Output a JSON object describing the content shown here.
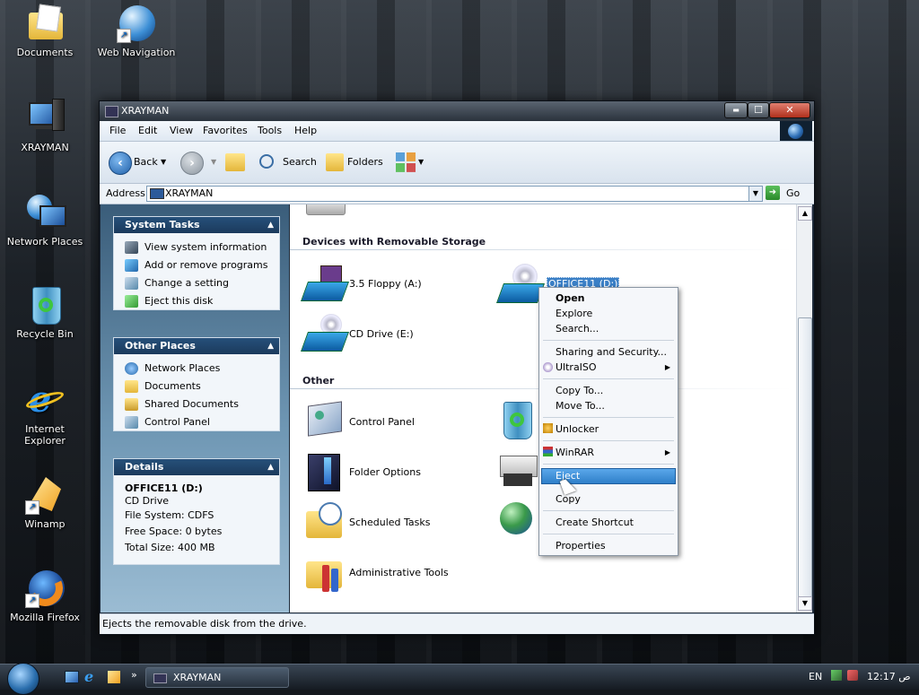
{
  "desktop": {
    "icons": [
      {
        "label": "Documents"
      },
      {
        "label": "Web Navigation"
      },
      {
        "label": "XRAYMAN"
      },
      {
        "label": "Network Places"
      },
      {
        "label": "Recycle Bin"
      },
      {
        "label": "Internet Explorer"
      },
      {
        "label": "Winamp"
      },
      {
        "label": "Mozilla Firefox"
      }
    ]
  },
  "window": {
    "title": "XRAYMAN",
    "buttons": {
      "minimize": "▬",
      "maximize": "☐",
      "close": "✕"
    }
  },
  "menu": [
    "File",
    "Edit",
    "View",
    "Favorites",
    "Tools",
    "Help"
  ],
  "toolbar": {
    "back": "Back",
    "search": "Search",
    "folders": "Folders"
  },
  "address": {
    "label": "Address",
    "value": "XRAYMAN",
    "go": "Go"
  },
  "sidebar": {
    "system_tasks": {
      "title": "System Tasks",
      "items": [
        "View system information",
        "Add or remove programs",
        "Change a setting",
        "Eject this disk"
      ]
    },
    "other_places": {
      "title": "Other Places",
      "items": [
        "Network Places",
        "Documents",
        "Shared Documents",
        "Control Panel"
      ]
    },
    "details": {
      "title": "Details",
      "name": "OFFICE11 (D:)",
      "type": "CD Drive",
      "filesystem": "File System: CDFS",
      "free": "Free Space: 0 bytes",
      "total": "Total Size: 400 MB"
    }
  },
  "content": {
    "removable_header": "Devices with Removable Storage",
    "removable": [
      "3.5 Floppy (A:)",
      "OFFICE11 (D:)",
      "CD Drive (E:)"
    ],
    "other_header": "Other",
    "other": [
      "Control Panel",
      "Folder Options",
      "Scheduled Tasks",
      "Administrative Tools"
    ]
  },
  "context_menu": {
    "items": [
      "Open",
      "Explore",
      "Search...",
      "Sharing and Security...",
      "UltraISO",
      "Copy To...",
      "Move To...",
      "Unlocker",
      "WinRAR",
      "Eject",
      "Copy",
      "Create Shortcut",
      "Properties"
    ],
    "highlighted": "Eject"
  },
  "statusbar": {
    "text": "Ejects the removable disk from the drive."
  },
  "taskbar": {
    "window_button": "XRAYMAN",
    "lang": "EN",
    "clock": "ص 12:17"
  },
  "colors": {
    "accent": "#2f7fc9",
    "panel_header": "#1b3a5c"
  }
}
